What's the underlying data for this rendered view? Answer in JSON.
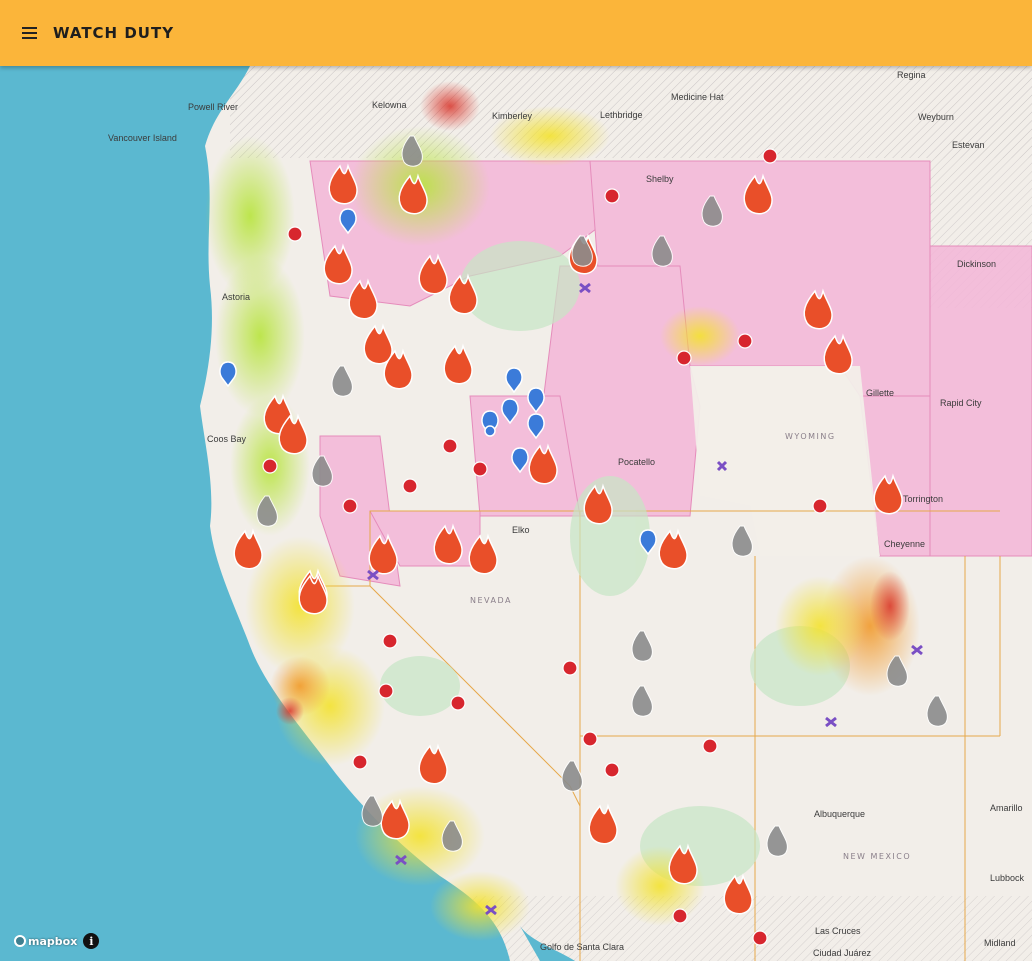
{
  "header": {
    "title": "WATCH DUTY",
    "menu_icon": "hamburger-menu-icon",
    "background_color": "#fbb53a"
  },
  "map": {
    "provider": "mapbox",
    "ocean_color": "#5bb8d0",
    "land_color": "#f2eee9",
    "red_flag_color": "#f1a9d2",
    "fire_icon_color": "#e94f29",
    "inactive_fire_color": "#8c8c8c",
    "cities": [
      "Powell River",
      "Kelowna",
      "Kimberley",
      "Lethbridge",
      "Medicine Hat",
      "Regina",
      "Weyburn",
      "Estevan",
      "Vancouver Island",
      "Shelby",
      "Dickinson",
      "Astoria",
      "Coos Bay",
      "Gillette",
      "Rapid City",
      "Pocatello",
      "Torrington",
      "Cheyenne",
      "Elko",
      "Albuquerque",
      "Amarillo",
      "Lubbock",
      "Las Cruces",
      "Ciudad Juárez",
      "Midland",
      "Golfo de Santa Clara"
    ],
    "state_labels": [
      "NEVADA",
      "WYOMING",
      "NEW MEXICO"
    ],
    "legend_icons": [
      "fire-icon",
      "inactive-fire-icon",
      "evacuation-icon",
      "aircraft-icon",
      "shelter-icon"
    ]
  },
  "attribution": {
    "logo_text": "mapbox",
    "info_label": "i"
  }
}
